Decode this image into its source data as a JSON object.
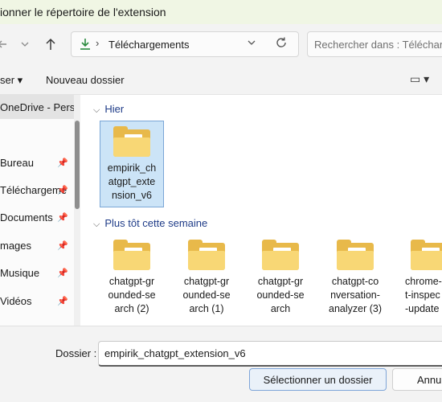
{
  "window": {
    "title": "ionner le répertoire de l'extension"
  },
  "nav": {
    "back_icon": "arrow-left-icon",
    "forward_icon": "chevron-down-icon",
    "up_icon": "arrow-up-icon",
    "path_separator": "›",
    "location": "Téléchargements",
    "search_placeholder": "Rechercher dans : Télécharg"
  },
  "commandbar": {
    "organize_label": "ser ▾",
    "new_folder_label": "Nouveau dossier",
    "view_label": "▭ ▾"
  },
  "sidebar": {
    "items": [
      {
        "label": "OneDrive - Perso",
        "pinned": false,
        "selected": true
      },
      {
        "label": "Bureau",
        "pinned": true
      },
      {
        "label": "Téléchargeme",
        "pinned": true
      },
      {
        "label": "Documents",
        "pinned": true
      },
      {
        "label": "mages",
        "pinned": true
      },
      {
        "label": "Musique",
        "pinned": true
      },
      {
        "label": "Vidéos",
        "pinned": true
      }
    ]
  },
  "content": {
    "group_today": {
      "label": "Hier"
    },
    "group_week": {
      "label": "Plus tôt cette semaine"
    },
    "folders_today": [
      {
        "name": "empirik_chatgpt_extension_v6",
        "lines": [
          "empirik_ch",
          "atgpt_exte",
          "nsion_v6"
        ],
        "selected": true
      }
    ],
    "folders_week": [
      {
        "name": "chatgpt-grounded-search (2)",
        "lines": [
          "chatgpt-gr",
          "ounded-se",
          "arch (2)"
        ]
      },
      {
        "name": "chatgpt-grounded-search (1)",
        "lines": [
          "chatgpt-gr",
          "ounded-se",
          "arch (1)"
        ]
      },
      {
        "name": "chatgpt-grounded-search",
        "lines": [
          "chatgpt-gr",
          "ounded-se",
          "arch"
        ]
      },
      {
        "name": "chatgpt-conversation-analyzer (3)",
        "lines": [
          "chatgpt-co",
          "nversation-",
          "analyzer (3)"
        ]
      },
      {
        "name": "chrome-t-inspect-update",
        "lines": [
          "chrome-",
          "t-inspec",
          "-update"
        ]
      }
    ]
  },
  "footer": {
    "folder_label": "Dossier :",
    "folder_value": "empirik_chatgpt_extension_v6",
    "select_button": "Sélectionner un dossier",
    "cancel_button": "Annu"
  }
}
